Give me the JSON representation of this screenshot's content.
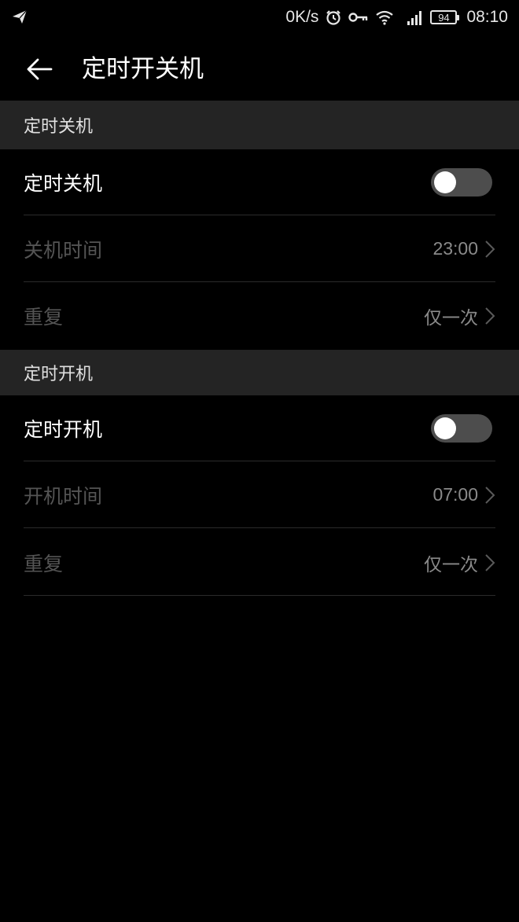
{
  "status_bar": {
    "net_speed": "0K/s",
    "battery_level": "94",
    "time": "08:10",
    "icons": [
      "send-icon",
      "alarm-icon",
      "vpn-key-icon",
      "wifi-icon",
      "signal-icon",
      "battery-icon"
    ]
  },
  "app_bar": {
    "title": "定时开关机",
    "back_icon": "arrow-left-icon"
  },
  "shutdown_section": {
    "header": "定时关机",
    "toggle_label": "定时关机",
    "toggle_on": false,
    "time_label": "关机时间",
    "time_value": "23:00",
    "repeat_label": "重复",
    "repeat_value": "仅一次"
  },
  "poweron_section": {
    "header": "定时开机",
    "toggle_label": "定时开机",
    "toggle_on": false,
    "time_label": "开机时间",
    "time_value": "07:00",
    "repeat_label": "重复",
    "repeat_value": "仅一次"
  },
  "colors": {
    "background": "#000000",
    "section_header_bg": "#242424",
    "disabled_text": "#545454",
    "value_text": "#8a8a8a",
    "toggle_track": "#4d4d4d"
  }
}
